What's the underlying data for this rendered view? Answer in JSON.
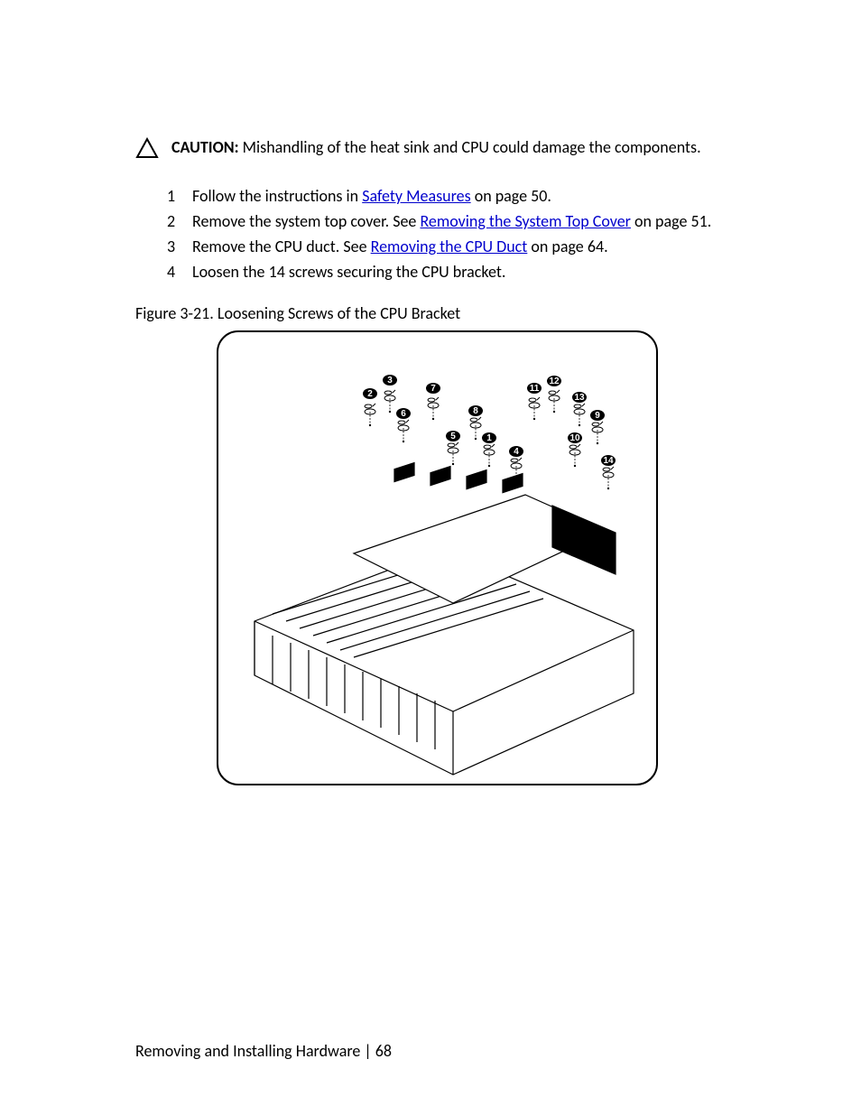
{
  "caution": {
    "lead": "CAUTION:",
    "text": " Mishandling of the heat sink and CPU could damage the components."
  },
  "steps": [
    {
      "prefix": "Follow the instructions in ",
      "link": "Safety Measures",
      "suffix": " on page 50."
    },
    {
      "prefix": "Remove the system top cover. See ",
      "link": "Removing the System Top Cover",
      "suffix": " on page 51."
    },
    {
      "prefix": "Remove the CPU duct. See ",
      "link": "Removing the CPU Duct",
      "suffix": " on page 64."
    },
    {
      "plain": "Loosen the 14 screws securing the CPU bracket."
    }
  ],
  "figure_label": "Figure 3-21. Loosening Screws of the CPU Bracket",
  "callouts": [
    "1",
    "2",
    "3",
    "4",
    "5",
    "6",
    "7",
    "8",
    "9",
    "10",
    "11",
    "12",
    "13",
    "14"
  ],
  "footer": {
    "title": "Removing and Installing Hardware",
    "sep": " | ",
    "page": "68"
  }
}
